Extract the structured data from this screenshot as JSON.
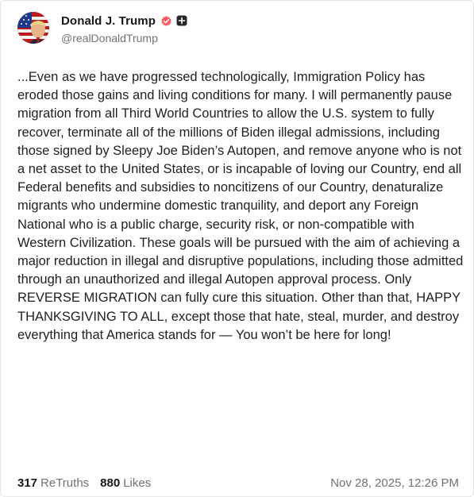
{
  "author": {
    "display_name": "Donald J. Trump",
    "handle": "@realDonaldTrump",
    "avatar_icon": "avatar-photo",
    "badges": [
      "verified-badge-icon",
      "plus-square-icon"
    ],
    "colors": {
      "verified": "#ff5a60",
      "badge_dark": "#27272a"
    }
  },
  "post": {
    "text": "...Even as we have progressed technologically, Immigration Policy has eroded those gains and living conditions for many. I will permanently pause migration from all Third World Countries to allow the U.S. system to fully recover, terminate all of the millions of Biden illegal admissions, including those signed by Sleepy Joe Biden’s Autopen, and remove anyone who is not a net asset to the United States, or is incapable of loving our Country, end all Federal benefits and subsidies to noncitizens of our Country, denaturalize migrants who undermine domestic tranquility, and deport any Foreign National who is a public charge, security risk, or non-compatible with Western Civilization. These goals will be pursued with the aim of achieving a major reduction in illegal and disruptive populations, including those admitted through an unauthorized and illegal Autopen approval process. Only REVERSE MIGRATION can fully cure this situation. Other than that, HAPPY THANKSGIVING TO ALL, except those that hate, steal, murder, and destroy everything that America stands for — You won’t be here for long!"
  },
  "stats": {
    "retruths_count": "317",
    "retruths_label": "ReTruths",
    "likes_count": "880",
    "likes_label": "Likes"
  },
  "timestamp": "Nov 28, 2025, 12:26 PM"
}
